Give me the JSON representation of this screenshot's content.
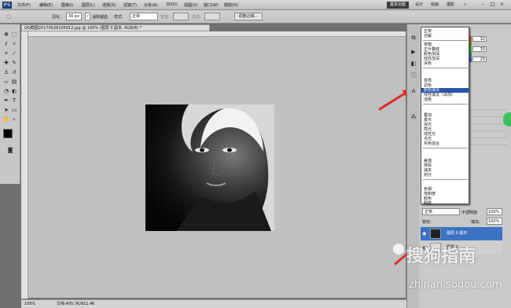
{
  "app": {
    "logo": "PS"
  },
  "menubar": {
    "items": [
      "文件(F)",
      "编辑(E)",
      "图像(I)",
      "图层(L)",
      "选择(S)",
      "滤镜(T)",
      "分析(A)",
      "3D(D)",
      "视图(V)",
      "窗口(W)",
      "帮助(H)"
    ],
    "workspaces": [
      "基本功能",
      "设计",
      "绘画",
      "摄影"
    ],
    "more": "»",
    "window_controls": [
      "–",
      "□",
      "×"
    ]
  },
  "options": {
    "feather_label": "羽化:",
    "feather_value": "30 px",
    "antialias_label": "消除锯齿",
    "style_label": "样式:",
    "style_value": "正常",
    "width_label": "宽度:",
    "height_label": "高度:",
    "refine_button": "调整边缘..."
  },
  "document": {
    "tab_title": "QQ截图20170526105912.jpg @ 100% (图层 0 副本, RGB/8) *",
    "zoom": "100%",
    "doc_info": "文档:405.7K/811.4K"
  },
  "blend_menu": {
    "groups": [
      [
        "正常",
        "溶解"
      ],
      [
        "变暗",
        "正片叠底",
        "颜色加深",
        "线性加深",
        "深色"
      ],
      [
        "变亮",
        "滤色",
        "颜色减淡",
        "线性减淡（添加）",
        "浅色"
      ],
      [
        "叠加",
        "柔光",
        "强光",
        "亮光",
        "线性光",
        "点光",
        "实色混合"
      ],
      [
        "差值",
        "排除",
        "减去",
        "划分"
      ],
      [
        "色相",
        "饱和度",
        "颜色",
        "明度"
      ]
    ],
    "highlighted": "颜色减淡"
  },
  "color_panel": {
    "values": [
      "32",
      "30",
      "25"
    ]
  },
  "layers": {
    "blend_value": "正常",
    "opacity_label": "不透明度:",
    "opacity_value": "100%",
    "lock_label": "锁定:",
    "fill_label": "填充:",
    "fill_value": "100%",
    "items": [
      {
        "name": "图层 0 副本",
        "selected": true
      },
      {
        "name": "图层 0",
        "selected": false
      }
    ]
  },
  "watermark": {
    "brand": "搜狗指南",
    "url": "zhinan.sogou.com"
  },
  "colors": {
    "accent": "#2a55a8",
    "arrow": "#e02a2a"
  }
}
